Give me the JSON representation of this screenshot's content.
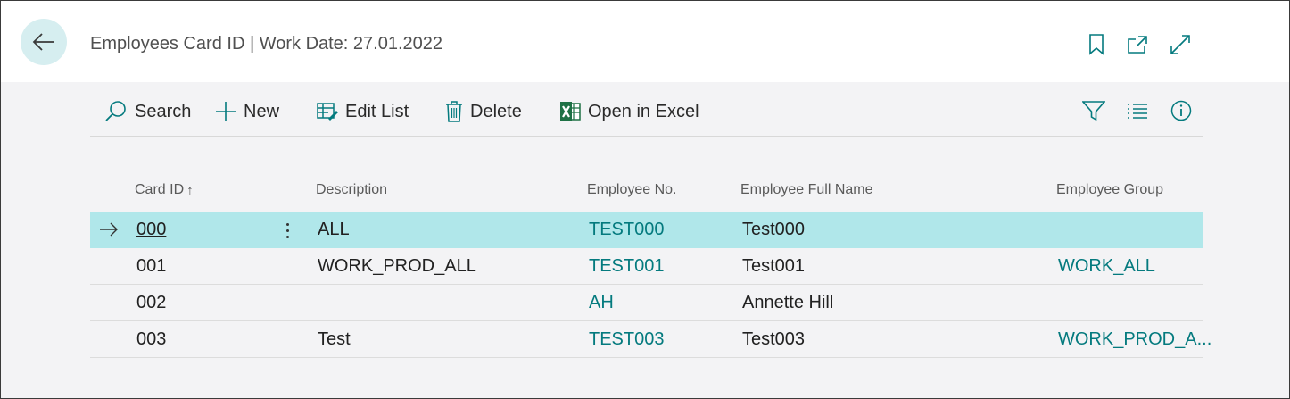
{
  "header": {
    "title": "Employees Card ID | Work Date: 27.01.2022"
  },
  "actions": {
    "search": "Search",
    "new": "New",
    "edit_list": "Edit List",
    "delete": "Delete",
    "open_in_excel": "Open in Excel"
  },
  "columns": {
    "card_id": "Card ID",
    "card_id_sort": "↑",
    "description": "Description",
    "employee_no": "Employee No.",
    "employee_full_name": "Employee Full Name",
    "employee_group": "Employee Group"
  },
  "rows": [
    {
      "card_id": "000",
      "description": "ALL",
      "employee_no": "TEST000",
      "employee_full_name": "Test000",
      "employee_group": ""
    },
    {
      "card_id": "001",
      "description": "WORK_PROD_ALL",
      "employee_no": "TEST001",
      "employee_full_name": "Test001",
      "employee_group": "WORK_ALL"
    },
    {
      "card_id": "002",
      "description": "",
      "employee_no": "AH",
      "employee_full_name": "Annette Hill",
      "employee_group": ""
    },
    {
      "card_id": "003",
      "description": "Test",
      "employee_no": "TEST003",
      "employee_full_name": "Test003",
      "employee_group": "WORK_PROD_A..."
    }
  ],
  "selected_row": 0,
  "colors": {
    "accent": "#047a7e",
    "selected_row": "#b0e7ea",
    "back_button": "#d6eef0"
  },
  "icons": [
    "back-arrow-icon",
    "bookmark-icon",
    "open-new-window-icon",
    "expand-icon",
    "search-icon",
    "plus-icon",
    "edit-list-icon",
    "trash-icon",
    "excel-icon",
    "filter-icon",
    "list-view-icon",
    "info-icon",
    "row-arrow-icon",
    "more-vertical-icon"
  ]
}
